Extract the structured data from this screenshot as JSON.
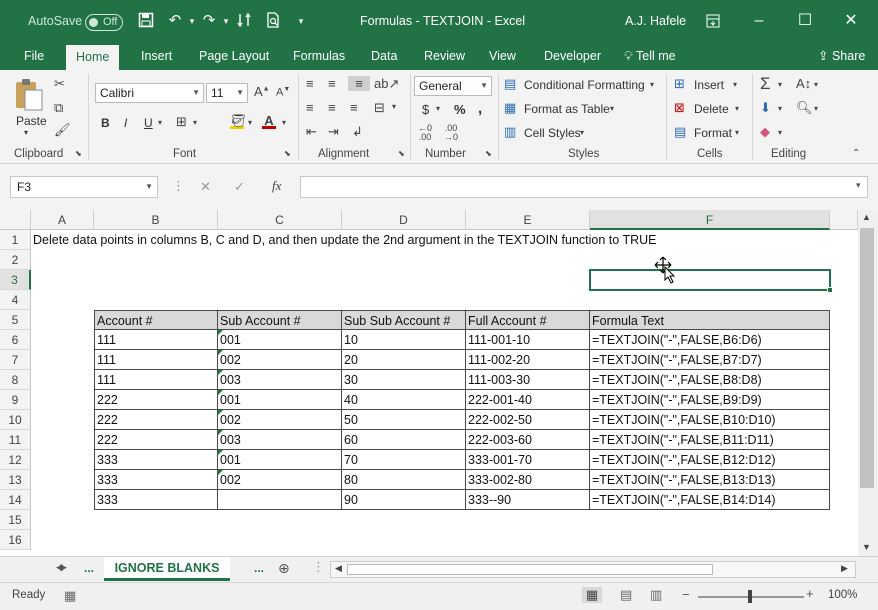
{
  "titlebar": {
    "autosave_label": "AutoSave",
    "autosave_state": "Off",
    "title": "Formulas - TEXTJOIN  -  Excel",
    "user": "A.J. Hafele"
  },
  "tabs": [
    "File",
    "Home",
    "Insert",
    "Page Layout",
    "Formulas",
    "Data",
    "Review",
    "View",
    "Developer",
    "Tell me",
    "Share"
  ],
  "ribbon": {
    "clipboard": {
      "paste": "Paste",
      "label": "Clipboard"
    },
    "font": {
      "name": "Calibri",
      "size": "11",
      "label": "Font",
      "bold": "B",
      "italic": "I",
      "underline": "U"
    },
    "alignment": {
      "label": "Alignment"
    },
    "number": {
      "format": "General",
      "label": "Number",
      "currency": "$",
      "percent": "%",
      "comma": ","
    },
    "styles": {
      "conditional": "Conditional Formatting",
      "table": "Format as Table",
      "cell": "Cell Styles",
      "label": "Styles"
    },
    "cells": {
      "insert": "Insert",
      "delete": "Delete",
      "format": "Format",
      "label": "Cells"
    },
    "editing": {
      "label": "Editing"
    }
  },
  "formula_bar": {
    "name_box": "F3",
    "fx": "fx",
    "formula": ""
  },
  "columns": [
    "A",
    "B",
    "C",
    "D",
    "E",
    "F"
  ],
  "rows": [
    "1",
    "2",
    "3",
    "4",
    "5",
    "6",
    "7",
    "8",
    "9",
    "10",
    "11",
    "12",
    "13",
    "14",
    "15",
    "16"
  ],
  "instruction": "Delete data points in columns B, C and D, and then update the 2nd argument in the TEXTJOIN function to TRUE",
  "table": {
    "headers": [
      "Account #",
      "Sub Account #",
      "Sub Sub Account #",
      "Full Account #",
      "Formula Text"
    ],
    "rows": [
      [
        "111",
        "001",
        "10",
        "111-001-10",
        "=TEXTJOIN(\"-\",FALSE,B6:D6)"
      ],
      [
        "111",
        "002",
        "20",
        "111-002-20",
        "=TEXTJOIN(\"-\",FALSE,B7:D7)"
      ],
      [
        "111",
        "003",
        "30",
        "111-003-30",
        "=TEXTJOIN(\"-\",FALSE,B8:D8)"
      ],
      [
        "222",
        "001",
        "40",
        "222-001-40",
        "=TEXTJOIN(\"-\",FALSE,B9:D9)"
      ],
      [
        "222",
        "002",
        "50",
        "222-002-50",
        "=TEXTJOIN(\"-\",FALSE,B10:D10)"
      ],
      [
        "222",
        "003",
        "60",
        "222-003-60",
        "=TEXTJOIN(\"-\",FALSE,B11:D11)"
      ],
      [
        "333",
        "001",
        "70",
        "333-001-70",
        "=TEXTJOIN(\"-\",FALSE,B12:D12)"
      ],
      [
        "333",
        "002",
        "80",
        "333-002-80",
        "=TEXTJOIN(\"-\",FALSE,B13:D13)"
      ],
      [
        "333",
        "",
        "90",
        "333--90",
        "=TEXTJOIN(\"-\",FALSE,B14:D14)"
      ]
    ]
  },
  "sheet_tabs": {
    "active": "IGNORE BLANKS",
    "more_left": "...",
    "more_right": "..."
  },
  "status": {
    "ready": "Ready",
    "zoom": "100%"
  },
  "colors": {
    "excel_green": "#217346",
    "header_fill": "#d9d9d9"
  }
}
